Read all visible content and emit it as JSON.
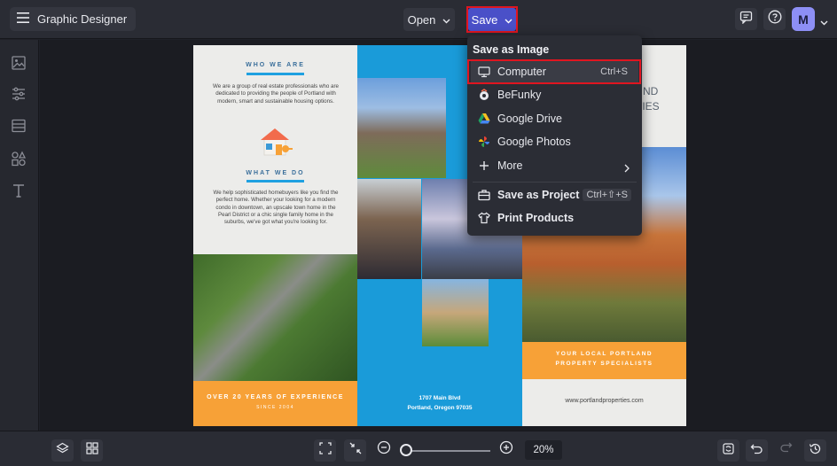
{
  "header": {
    "app_name": "Graphic Designer",
    "open_label": "Open",
    "save_label": "Save",
    "avatar_initial": "M"
  },
  "save_menu": {
    "title": "Save as Image",
    "items": [
      {
        "label": "Computer",
        "shortcut": "Ctrl+S",
        "icon": "monitor-icon"
      },
      {
        "label": "BeFunky",
        "icon": "befunky-icon"
      },
      {
        "label": "Google Drive",
        "icon": "google-drive-icon"
      },
      {
        "label": "Google Photos",
        "icon": "google-photos-icon"
      },
      {
        "label": "More",
        "icon": "plus-icon"
      },
      {
        "label": "Save as Project",
        "shortcut": "Ctrl+⇧+S",
        "icon": "briefcase-icon"
      },
      {
        "label": "Print Products",
        "icon": "shirt-icon"
      }
    ]
  },
  "brochure": {
    "panel1": {
      "who_heading": "WHO WE ARE",
      "who_text": "We are a group of real estate professionals who are dedicated to providing the people of Portland with modern, smart and sustainable housing options.",
      "what_heading": "WHAT WE DO",
      "what_text": "We help sophisticated homebuyers like you find the perfect home. Whether your looking for a modern condo in downtown, an upscale town home in the Pearl District or a chic single family home in the suburbs, we've got what you're looking for.",
      "footer_line1": "OVER 20 YEARS OF EXPERIENCE",
      "footer_line2": "SINCE 2004"
    },
    "panel2": {
      "address_line1": "1707 Main Blvd",
      "address_line2": "Portland, Oregon 97035"
    },
    "panel3": {
      "title_line1": "ND",
      "title_line2": "TIES",
      "banner_line1": "YOUR LOCAL PORTLAND",
      "banner_line2": "PROPERTY SPECIALISTS",
      "website": "www.portlandproperties.com"
    }
  },
  "footer": {
    "zoom": "20%"
  },
  "colors": {
    "accent": "#4a50c8",
    "highlight_box": "#e01520",
    "brochure_blue": "#1a9bd9",
    "brochure_orange": "#f7a137"
  }
}
